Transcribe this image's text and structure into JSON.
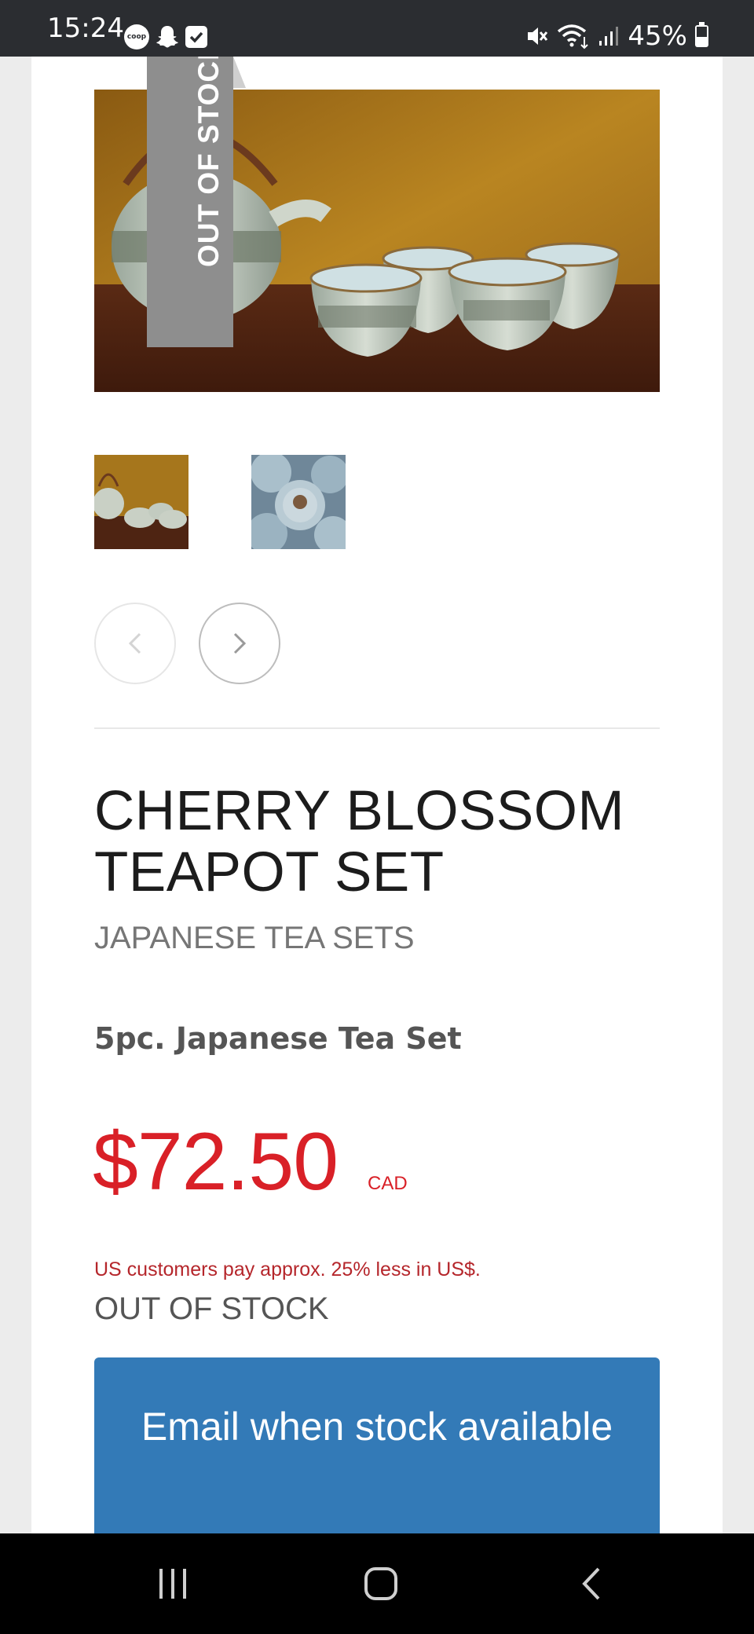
{
  "status_bar": {
    "time": "15:24",
    "left_icons": [
      "coop-icon",
      "snapchat-icon",
      "checkbox-icon"
    ],
    "coop_label": "coop",
    "right_icons": [
      "mute-icon",
      "wifi-icon",
      "signal-icon"
    ],
    "battery_percent": "45%",
    "battery_level": 0.45
  },
  "product": {
    "badge": "OUT OF STOCK",
    "title": "CHERRY BLOSSOM TEAPOT SET",
    "category": "JAPANESE TEA SETS",
    "subtitle": "5pc. Japanese Tea Set",
    "price": "$72.50",
    "currency": "CAD",
    "us_note": "US customers pay approx. 25% less in US$.",
    "stock_status": "OUT OF STOCK",
    "email_button": "Email when stock available"
  },
  "gallery": {
    "thumbnails": 2,
    "prev_icon": "chevron-left-icon",
    "next_icon": "chevron-right-icon"
  },
  "system_nav": {
    "items": [
      "recent-apps-icon",
      "home-icon",
      "back-icon"
    ]
  },
  "colors": {
    "price_red": "#d92027",
    "button_blue": "#337ab7",
    "ribbon_gray": "#8e8e8e"
  }
}
